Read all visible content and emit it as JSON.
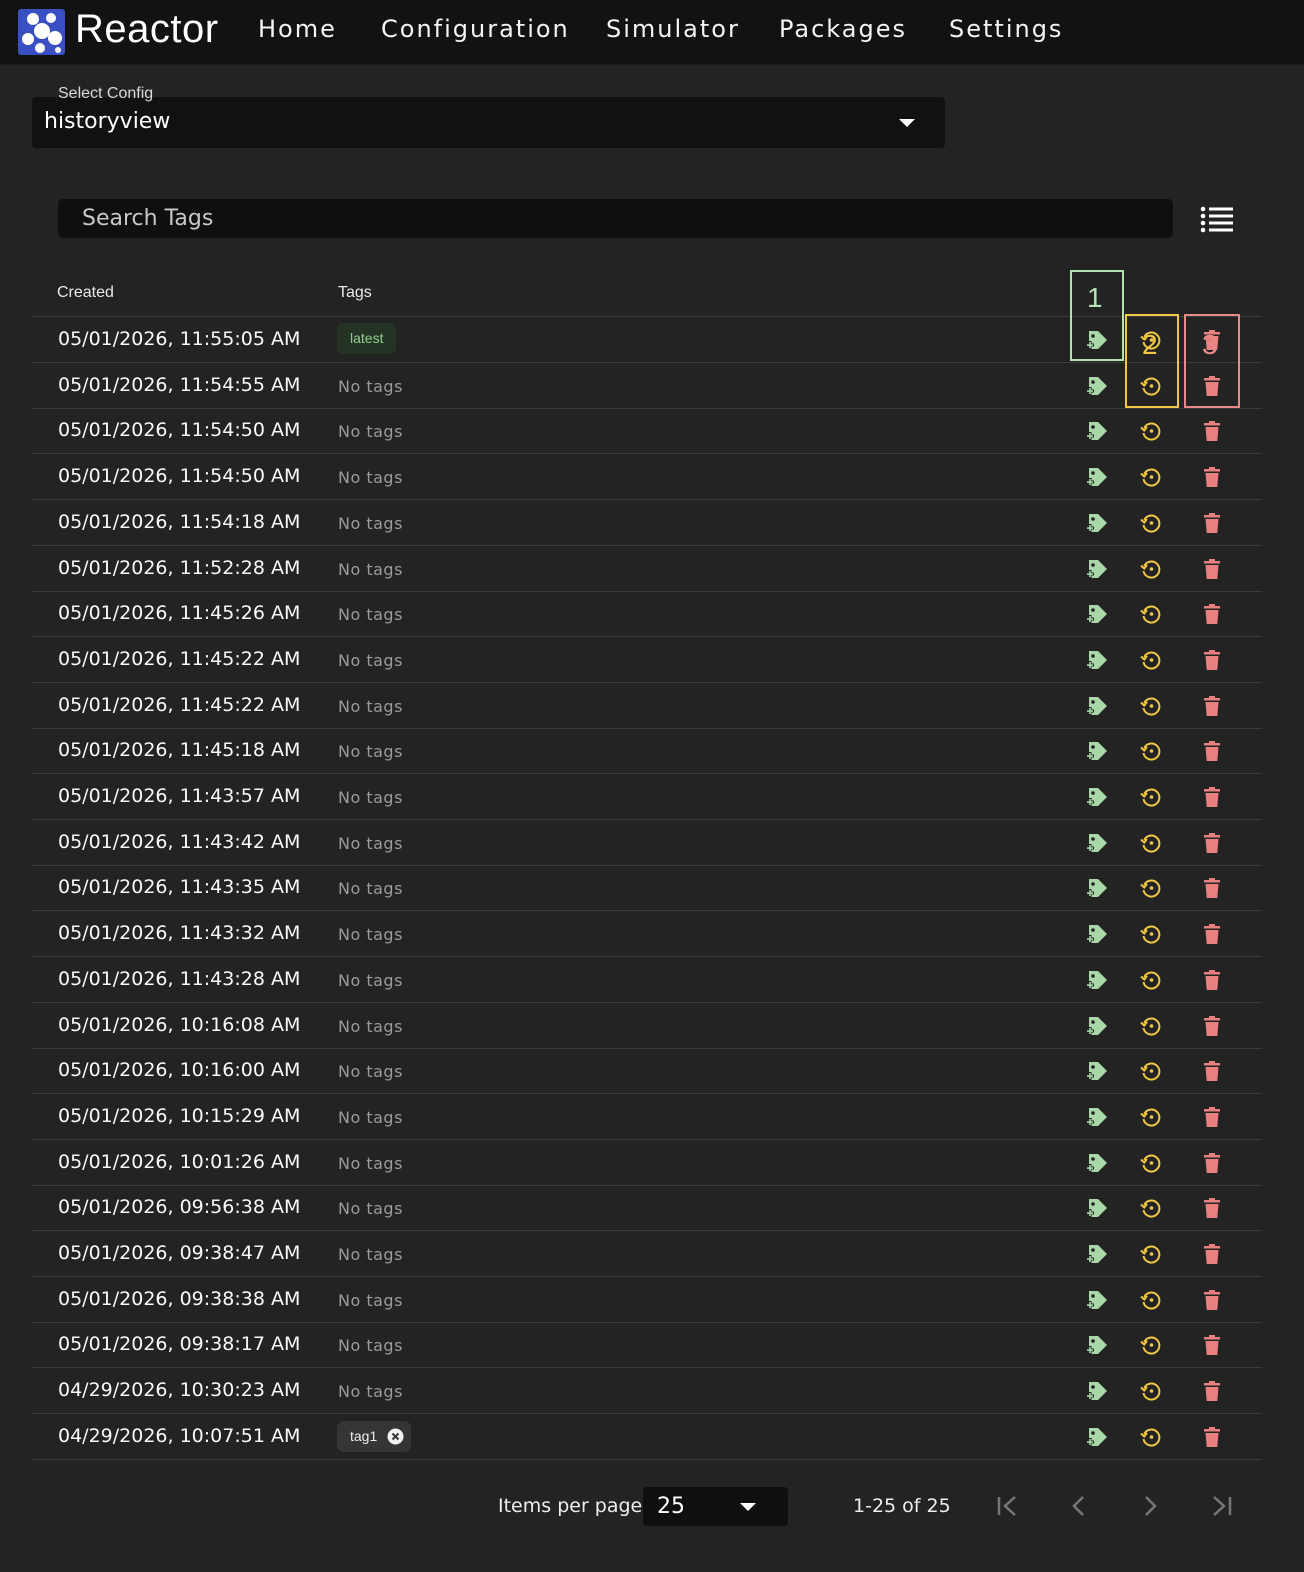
{
  "app": {
    "brand": "Reactor",
    "nav": [
      "Home",
      "Configuration",
      "Simulator",
      "Packages",
      "Settings"
    ]
  },
  "config": {
    "label": "Select Config",
    "value": "historyview"
  },
  "search": {
    "placeholder": "Search Tags"
  },
  "table": {
    "headers": {
      "created": "Created",
      "tags": "Tags"
    },
    "no_tags_text": "No tags",
    "rows": [
      {
        "created": "05/01/2026, 11:55:05 AM",
        "tag": "latest"
      },
      {
        "created": "05/01/2026, 11:54:55 AM",
        "tag": null
      },
      {
        "created": "05/01/2026, 11:54:50 AM",
        "tag": null
      },
      {
        "created": "05/01/2026, 11:54:50 AM",
        "tag": null
      },
      {
        "created": "05/01/2026, 11:54:18 AM",
        "tag": null
      },
      {
        "created": "05/01/2026, 11:52:28 AM",
        "tag": null
      },
      {
        "created": "05/01/2026, 11:45:26 AM",
        "tag": null
      },
      {
        "created": "05/01/2026, 11:45:22 AM",
        "tag": null
      },
      {
        "created": "05/01/2026, 11:45:22 AM",
        "tag": null
      },
      {
        "created": "05/01/2026, 11:45:18 AM",
        "tag": null
      },
      {
        "created": "05/01/2026, 11:43:57 AM",
        "tag": null
      },
      {
        "created": "05/01/2026, 11:43:42 AM",
        "tag": null
      },
      {
        "created": "05/01/2026, 11:43:35 AM",
        "tag": null
      },
      {
        "created": "05/01/2026, 11:43:32 AM",
        "tag": null
      },
      {
        "created": "05/01/2026, 11:43:28 AM",
        "tag": null
      },
      {
        "created": "05/01/2026, 10:16:08 AM",
        "tag": null
      },
      {
        "created": "05/01/2026, 10:16:00 AM",
        "tag": null
      },
      {
        "created": "05/01/2026, 10:15:29 AM",
        "tag": null
      },
      {
        "created": "05/01/2026, 10:01:26 AM",
        "tag": null
      },
      {
        "created": "05/01/2026, 09:56:38 AM",
        "tag": null
      },
      {
        "created": "05/01/2026, 09:38:47 AM",
        "tag": null
      },
      {
        "created": "05/01/2026, 09:38:38 AM",
        "tag": null
      },
      {
        "created": "05/01/2026, 09:38:17 AM",
        "tag": null
      },
      {
        "created": "04/29/2026, 10:30:23 AM",
        "tag": null
      },
      {
        "created": "04/29/2026, 10:07:51 AM",
        "tag": "tag1",
        "removable": true
      }
    ],
    "actions": [
      "add-tag-icon",
      "restore-icon",
      "delete-icon"
    ]
  },
  "annotations": {
    "box1": "1",
    "box2": "2",
    "box3": "3"
  },
  "pagination": {
    "items_per_page_label": "Items per page:",
    "items_per_page": "25",
    "range": "1-25 of 25"
  },
  "colors": {
    "add_tag": "#a8d8a8",
    "restore": "#f2c744",
    "delete": "#e88080",
    "box1": "#b5e2b5",
    "box2": "#f2c744",
    "box3": "#e88a8a"
  }
}
